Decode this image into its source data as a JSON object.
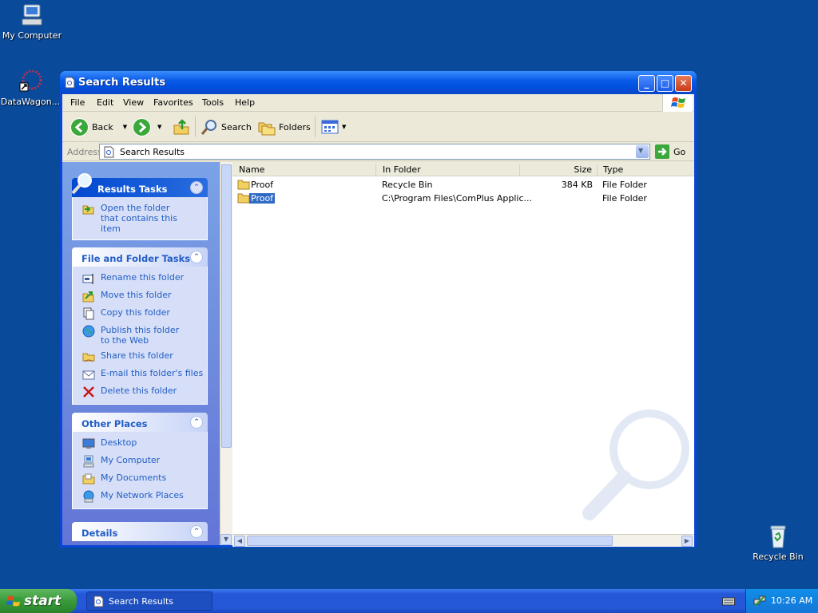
{
  "desktop": {
    "icons": [
      {
        "label": "My Computer"
      },
      {
        "label": "DataWagon..."
      },
      {
        "label": "Recycle Bin"
      }
    ]
  },
  "window": {
    "title": "Search Results",
    "menu": [
      "File",
      "Edit",
      "View",
      "Favorites",
      "Tools",
      "Help"
    ],
    "toolbar": {
      "back": "Back",
      "search": "Search",
      "folders": "Folders"
    },
    "address": {
      "label": "Address",
      "value": "Search Results",
      "go": "Go"
    },
    "left_pane": {
      "results_tasks": {
        "title": "Results Tasks",
        "items": [
          "Open the folder that contains this item"
        ]
      },
      "file_folder_tasks": {
        "title": "File and Folder Tasks",
        "items": [
          "Rename this folder",
          "Move this folder",
          "Copy this folder",
          "Publish this folder to the Web",
          "Share this folder",
          "E-mail this folder's files",
          "Delete this folder"
        ]
      },
      "other_places": {
        "title": "Other Places",
        "items": [
          "Desktop",
          "My Computer",
          "My Documents",
          "My Network Places"
        ]
      },
      "details": {
        "title": "Details"
      }
    },
    "list": {
      "columns": [
        "Name",
        "In Folder",
        "Size",
        "Type"
      ],
      "rows": [
        {
          "name": "Proof",
          "folder": "Recycle Bin",
          "size": "384 KB",
          "type": "File Folder",
          "selected": false
        },
        {
          "name": "Proof",
          "folder": "C:\\Program Files\\ComPlus Applic...",
          "size": "",
          "type": "File Folder",
          "selected": true
        }
      ]
    }
  },
  "taskbar": {
    "start": "start",
    "task": "Search Results",
    "clock": "10:26 AM"
  }
}
